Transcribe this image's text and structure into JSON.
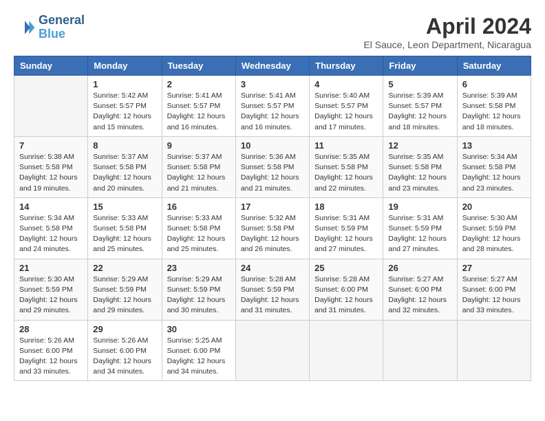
{
  "header": {
    "logo_line1": "General",
    "logo_line2": "Blue",
    "title": "April 2024",
    "subtitle": "El Sauce, Leon Department, Nicaragua"
  },
  "columns": [
    "Sunday",
    "Monday",
    "Tuesday",
    "Wednesday",
    "Thursday",
    "Friday",
    "Saturday"
  ],
  "rows": [
    [
      {
        "day": "",
        "info": ""
      },
      {
        "day": "1",
        "info": "Sunrise: 5:42 AM\nSunset: 5:57 PM\nDaylight: 12 hours\nand 15 minutes."
      },
      {
        "day": "2",
        "info": "Sunrise: 5:41 AM\nSunset: 5:57 PM\nDaylight: 12 hours\nand 16 minutes."
      },
      {
        "day": "3",
        "info": "Sunrise: 5:41 AM\nSunset: 5:57 PM\nDaylight: 12 hours\nand 16 minutes."
      },
      {
        "day": "4",
        "info": "Sunrise: 5:40 AM\nSunset: 5:57 PM\nDaylight: 12 hours\nand 17 minutes."
      },
      {
        "day": "5",
        "info": "Sunrise: 5:39 AM\nSunset: 5:57 PM\nDaylight: 12 hours\nand 18 minutes."
      },
      {
        "day": "6",
        "info": "Sunrise: 5:39 AM\nSunset: 5:58 PM\nDaylight: 12 hours\nand 18 minutes."
      }
    ],
    [
      {
        "day": "7",
        "info": "Sunrise: 5:38 AM\nSunset: 5:58 PM\nDaylight: 12 hours\nand 19 minutes."
      },
      {
        "day": "8",
        "info": "Sunrise: 5:37 AM\nSunset: 5:58 PM\nDaylight: 12 hours\nand 20 minutes."
      },
      {
        "day": "9",
        "info": "Sunrise: 5:37 AM\nSunset: 5:58 PM\nDaylight: 12 hours\nand 21 minutes."
      },
      {
        "day": "10",
        "info": "Sunrise: 5:36 AM\nSunset: 5:58 PM\nDaylight: 12 hours\nand 21 minutes."
      },
      {
        "day": "11",
        "info": "Sunrise: 5:35 AM\nSunset: 5:58 PM\nDaylight: 12 hours\nand 22 minutes."
      },
      {
        "day": "12",
        "info": "Sunrise: 5:35 AM\nSunset: 5:58 PM\nDaylight: 12 hours\nand 23 minutes."
      },
      {
        "day": "13",
        "info": "Sunrise: 5:34 AM\nSunset: 5:58 PM\nDaylight: 12 hours\nand 23 minutes."
      }
    ],
    [
      {
        "day": "14",
        "info": "Sunrise: 5:34 AM\nSunset: 5:58 PM\nDaylight: 12 hours\nand 24 minutes."
      },
      {
        "day": "15",
        "info": "Sunrise: 5:33 AM\nSunset: 5:58 PM\nDaylight: 12 hours\nand 25 minutes."
      },
      {
        "day": "16",
        "info": "Sunrise: 5:33 AM\nSunset: 5:58 PM\nDaylight: 12 hours\nand 25 minutes."
      },
      {
        "day": "17",
        "info": "Sunrise: 5:32 AM\nSunset: 5:58 PM\nDaylight: 12 hours\nand 26 minutes."
      },
      {
        "day": "18",
        "info": "Sunrise: 5:31 AM\nSunset: 5:59 PM\nDaylight: 12 hours\nand 27 minutes."
      },
      {
        "day": "19",
        "info": "Sunrise: 5:31 AM\nSunset: 5:59 PM\nDaylight: 12 hours\nand 27 minutes."
      },
      {
        "day": "20",
        "info": "Sunrise: 5:30 AM\nSunset: 5:59 PM\nDaylight: 12 hours\nand 28 minutes."
      }
    ],
    [
      {
        "day": "21",
        "info": "Sunrise: 5:30 AM\nSunset: 5:59 PM\nDaylight: 12 hours\nand 29 minutes."
      },
      {
        "day": "22",
        "info": "Sunrise: 5:29 AM\nSunset: 5:59 PM\nDaylight: 12 hours\nand 29 minutes."
      },
      {
        "day": "23",
        "info": "Sunrise: 5:29 AM\nSunset: 5:59 PM\nDaylight: 12 hours\nand 30 minutes."
      },
      {
        "day": "24",
        "info": "Sunrise: 5:28 AM\nSunset: 5:59 PM\nDaylight: 12 hours\nand 31 minutes."
      },
      {
        "day": "25",
        "info": "Sunrise: 5:28 AM\nSunset: 6:00 PM\nDaylight: 12 hours\nand 31 minutes."
      },
      {
        "day": "26",
        "info": "Sunrise: 5:27 AM\nSunset: 6:00 PM\nDaylight: 12 hours\nand 32 minutes."
      },
      {
        "day": "27",
        "info": "Sunrise: 5:27 AM\nSunset: 6:00 PM\nDaylight: 12 hours\nand 33 minutes."
      }
    ],
    [
      {
        "day": "28",
        "info": "Sunrise: 5:26 AM\nSunset: 6:00 PM\nDaylight: 12 hours\nand 33 minutes."
      },
      {
        "day": "29",
        "info": "Sunrise: 5:26 AM\nSunset: 6:00 PM\nDaylight: 12 hours\nand 34 minutes."
      },
      {
        "day": "30",
        "info": "Sunrise: 5:25 AM\nSunset: 6:00 PM\nDaylight: 12 hours\nand 34 minutes."
      },
      {
        "day": "",
        "info": ""
      },
      {
        "day": "",
        "info": ""
      },
      {
        "day": "",
        "info": ""
      },
      {
        "day": "",
        "info": ""
      }
    ]
  ]
}
